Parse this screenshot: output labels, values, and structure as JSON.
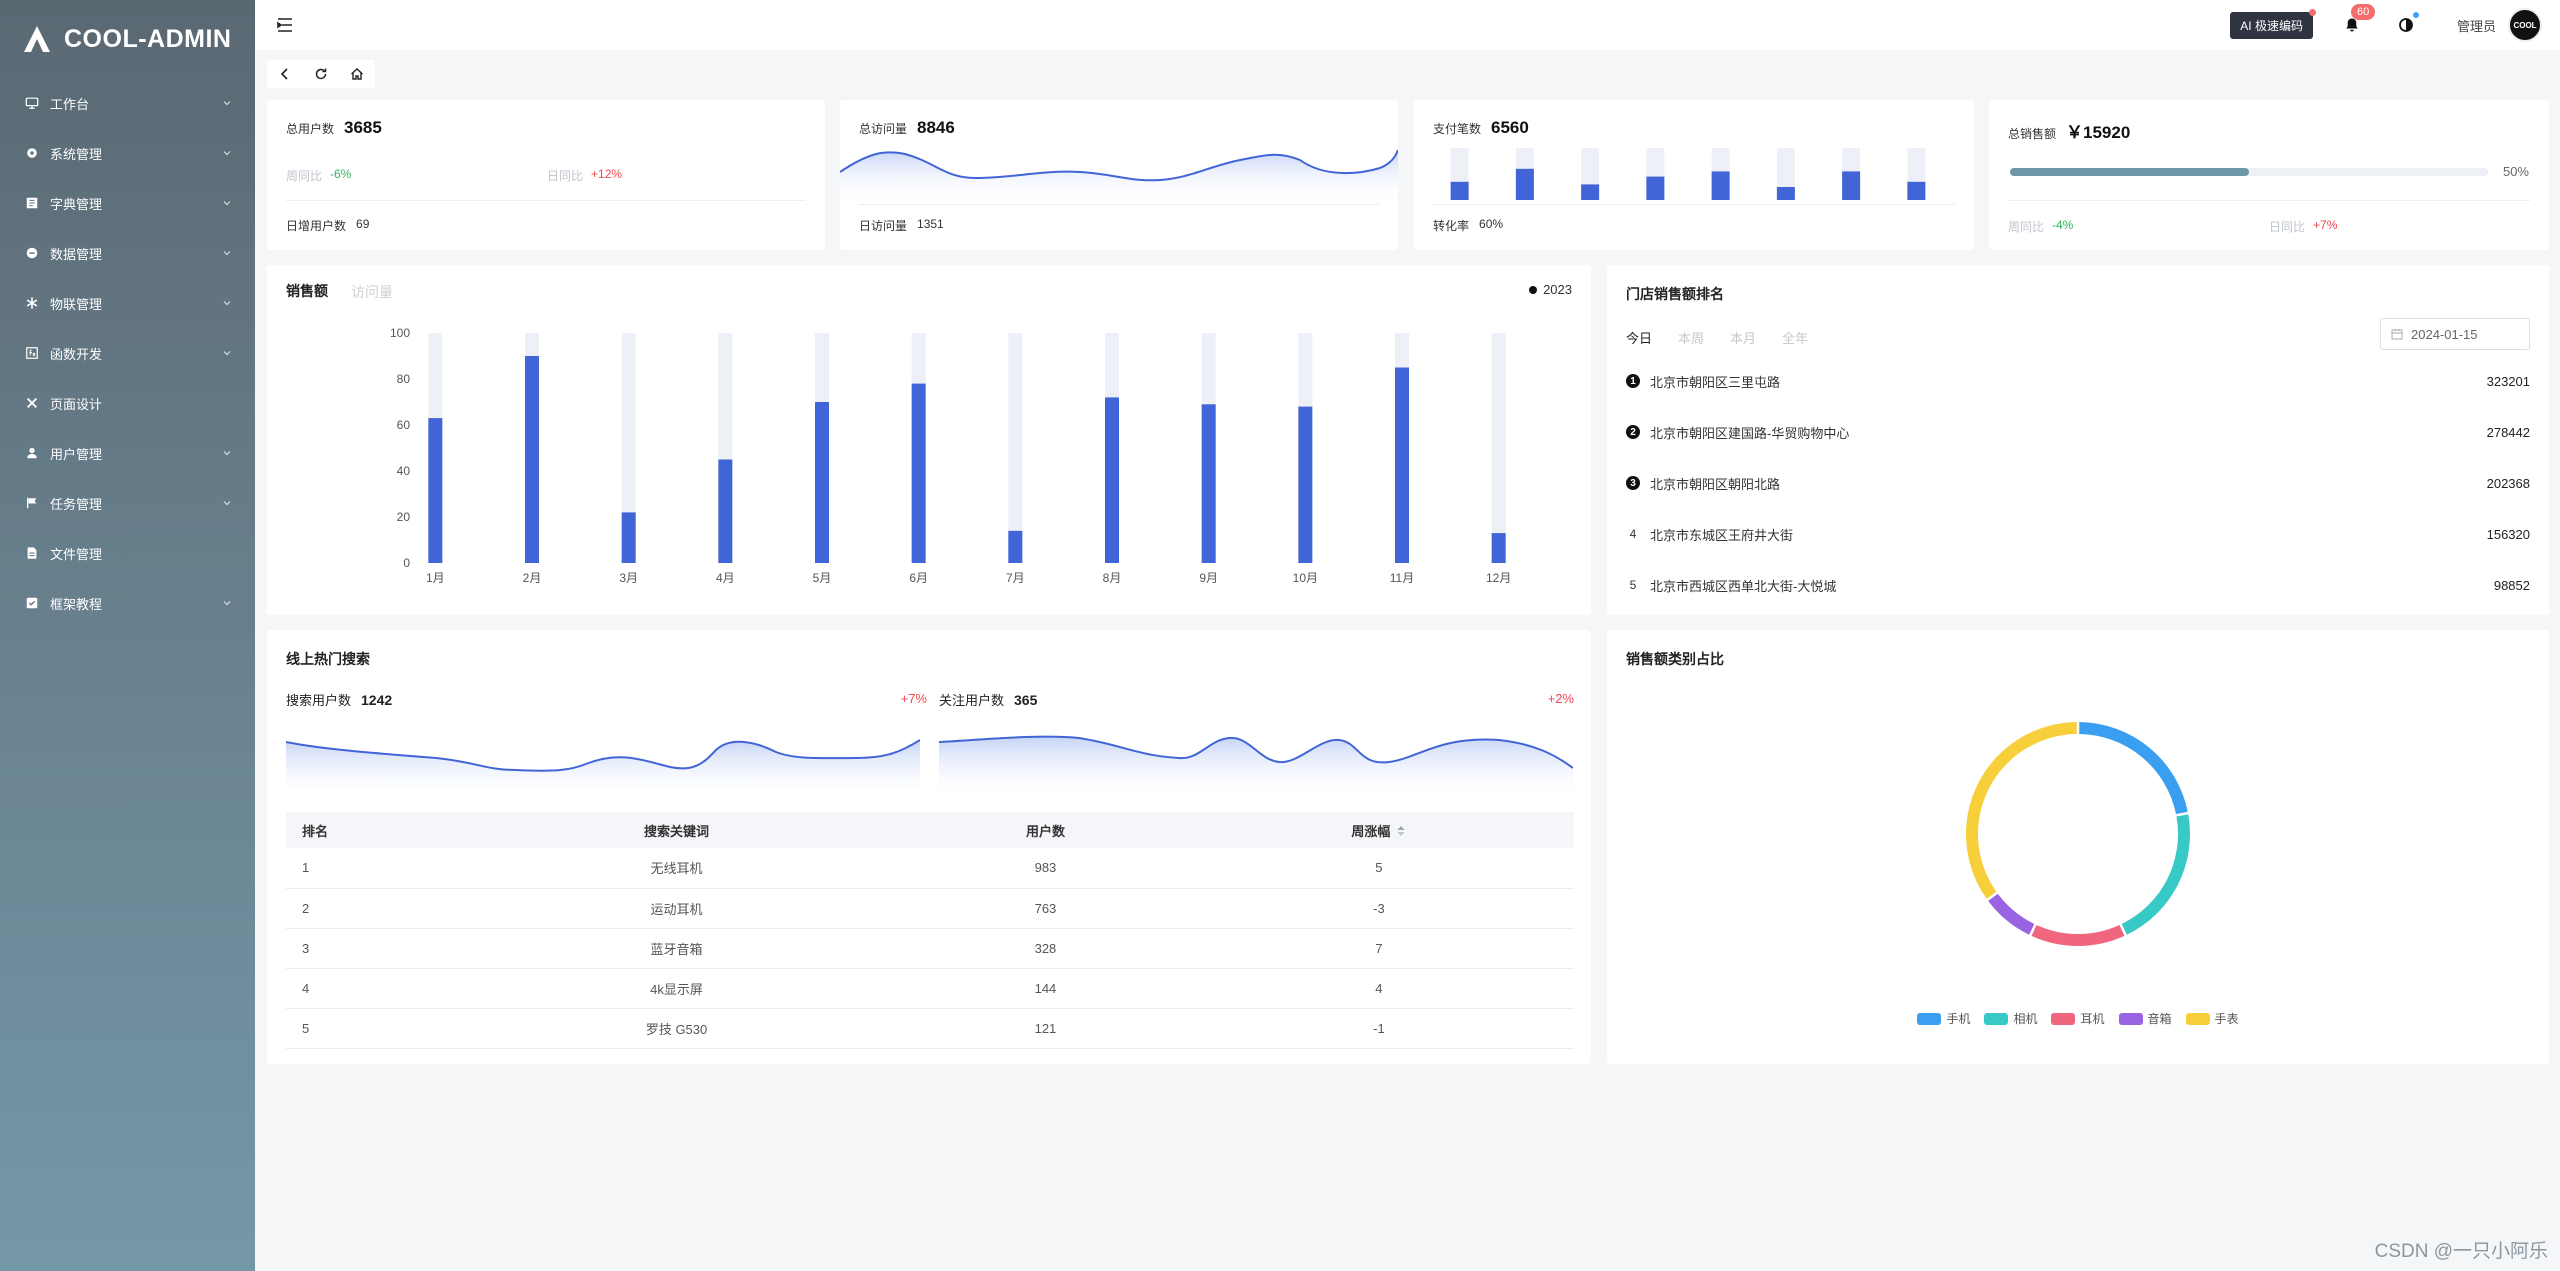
{
  "app": {
    "logo_text": "COOL-ADMIN"
  },
  "sidebar": {
    "items": [
      {
        "label": "工作台",
        "icon": "monitor-icon",
        "has_arrow": true
      },
      {
        "label": "系统管理",
        "icon": "gear-icon",
        "has_arrow": true
      },
      {
        "label": "字典管理",
        "icon": "book-icon",
        "has_arrow": true
      },
      {
        "label": "数据管理",
        "icon": "minus-circle-icon",
        "has_arrow": true
      },
      {
        "label": "物联管理",
        "icon": "snowflake-icon",
        "has_arrow": true
      },
      {
        "label": "函数开发",
        "icon": "function-icon",
        "has_arrow": true
      },
      {
        "label": "页面设计",
        "icon": "tools-icon",
        "has_arrow": false
      },
      {
        "label": "用户管理",
        "icon": "user-icon",
        "has_arrow": true
      },
      {
        "label": "任务管理",
        "icon": "flag-icon",
        "has_arrow": true
      },
      {
        "label": "文件管理",
        "icon": "file-icon",
        "has_arrow": false
      },
      {
        "label": "框架教程",
        "icon": "checkbook-icon",
        "has_arrow": true
      }
    ]
  },
  "header": {
    "ai_button": "AI 极速编码",
    "notification_count": "60",
    "username": "管理员",
    "avatar_text": "COOL"
  },
  "kpi": {
    "users": {
      "label": "总用户数",
      "value": "3685",
      "week_label": "周同比",
      "week_value": "-6%",
      "day_label": "日同比",
      "day_value": "+12%",
      "foot_label": "日增用户数",
      "foot_value": "69"
    },
    "visits": {
      "label": "总访问量",
      "value": "8846",
      "foot_label": "日访问量",
      "foot_value": "1351"
    },
    "payments": {
      "label": "支付笔数",
      "value": "6560",
      "foot_label": "转化率",
      "foot_value": "60%",
      "bars": [
        0.35,
        0.6,
        0.3,
        0.45,
        0.55,
        0.25,
        0.55,
        0.35
      ]
    },
    "sales": {
      "label": "总销售额",
      "value": "￥15920",
      "progress": 0.5,
      "progress_label": "50%",
      "week_label": "周同比",
      "week_value": "-4%",
      "day_label": "日同比",
      "day_value": "+7%"
    }
  },
  "sales_chart": {
    "tab_active": "销售额",
    "tab_inactive": "访问量",
    "legend_label": "2023",
    "bar_color": "#4165d7",
    "track_color": "#eef0f8"
  },
  "chart_data": {
    "type": "bar",
    "categories": [
      "1月",
      "2月",
      "3月",
      "4月",
      "5月",
      "6月",
      "7月",
      "8月",
      "9月",
      "10月",
      "11月",
      "12月"
    ],
    "series": [
      {
        "name": "2023",
        "values": [
          63,
          90,
          22,
          45,
          70,
          78,
          14,
          72,
          69,
          68,
          85,
          13
        ]
      }
    ],
    "ylim": [
      0,
      100
    ],
    "yticks": [
      0,
      20,
      40,
      60,
      80,
      100
    ],
    "background_max": 100
  },
  "ranking": {
    "title": "门店销售额排名",
    "tabs": [
      "今日",
      "本周",
      "本月",
      "全年"
    ],
    "date": "2024-01-15",
    "rows": [
      {
        "rank": "1",
        "address": "北京市朝阳区三里屯路",
        "value": "323201"
      },
      {
        "rank": "2",
        "address": "北京市朝阳区建国路-华贸购物中心",
        "value": "278442"
      },
      {
        "rank": "3",
        "address": "北京市朝阳区朝阳北路",
        "value": "202368"
      },
      {
        "rank": "4",
        "address": "北京市东城区王府井大街",
        "value": "156320"
      },
      {
        "rank": "5",
        "address": "北京市西城区西单北大街-大悦城",
        "value": "98852"
      }
    ]
  },
  "hot_search": {
    "title": "线上热门搜索",
    "search_users_label": "搜索用户数",
    "search_users_value": "1242",
    "search_users_pct": "+7%",
    "follow_users_label": "关注用户数",
    "follow_users_value": "365",
    "follow_users_pct": "+2%",
    "columns": [
      "排名",
      "搜索关键词",
      "用户数",
      "周涨幅"
    ],
    "rows": [
      [
        "1",
        "无线耳机",
        "983",
        "5"
      ],
      [
        "2",
        "运动耳机",
        "763",
        "-3"
      ],
      [
        "3",
        "蓝牙音箱",
        "328",
        "7"
      ],
      [
        "4",
        "4k显示屏",
        "144",
        "4"
      ],
      [
        "5",
        "罗技 G530",
        "121",
        "-1"
      ]
    ]
  },
  "category": {
    "title": "销售额类别占比",
    "items": [
      {
        "name": "手机",
        "value": 22,
        "color": "#3a9ff0"
      },
      {
        "name": "相机",
        "value": 21,
        "color": "#36c9c6"
      },
      {
        "name": "耳机",
        "value": 14,
        "color": "#f0667f"
      },
      {
        "name": "音箱",
        "value": 8,
        "color": "#9a63e3"
      },
      {
        "name": "手表",
        "value": 35,
        "color": "#f7cf3b"
      }
    ]
  },
  "watermark": "CSDN @一只小阿乐"
}
